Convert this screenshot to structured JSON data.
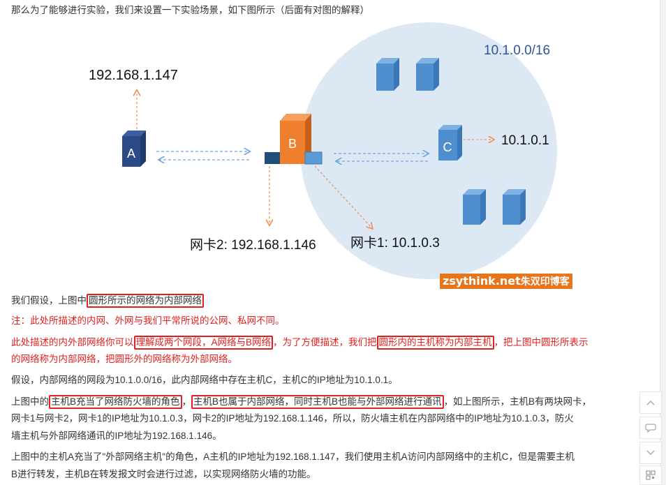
{
  "intro": "那么为了能够进行实验，我们来设置一下实验场景，如下图所示（后面有对图的解释）",
  "diagram": {
    "subnet_label": "10.1.0.0/16",
    "host_a_ip": "192.168.1.147",
    "host_a_label": "A",
    "host_b_label": "B",
    "host_c_label": "C",
    "host_c_ip": "10.1.0.1",
    "nic2_label": "网卡2: 192.168.1.146",
    "nic1_label": "网卡1: 10.1.0.3",
    "colors": {
      "circle": "#dce8f4",
      "host_dark": "#2c4a86",
      "host_blue": "#4f8fd0",
      "host_b": "#f07f2d",
      "arrow_orange": "#f0915a",
      "arrow_blue": "#6fa8dc"
    }
  },
  "watermark": {
    "site": "zsythink.net",
    "blog": "朱双印博客"
  },
  "paragraphs": {
    "p1_pre": "我们假设，上图中",
    "p1_box": "圆形所示的网络为内部网络",
    "note1": "注：此处所描述的内网、外网与我们平常所说的公网、私网不同。",
    "note2_pre": "此处描述的内外部网络你可以",
    "note2_box1": "理解成两个网段，A网络与B网络",
    "note2_mid": "，为了方便描述，我们把",
    "note2_box2": "圆形内的主机称为内部主机",
    "note2_post": "，把上图中圆形所表示",
    "note2_line2": "的网络称为内部网络，把圆形外的网络称为外部网络。",
    "p2": "假设，内部网络的网段为10.1.0.0/16，此内部网络中存在主机C，主机C的IP地址为10.1.0.1。",
    "p3_pre": "上图中的",
    "p3_box1": "主机B充当了网络防火墙的角色",
    "p3_mid": "，",
    "p3_box2": "主机B也属于内部网络，同时主机B也能与外部网络进行通讯",
    "p3_post": "，如上图所示，主机B有两块网卡，",
    "p3_line2": "网卡1与网卡2，网卡1的IP地址为10.1.0.3，网卡2的IP地址为192.168.1.146，所以，防火墙主机在内部网络中的IP地址为10.1.0.3，防火",
    "p3_line3": "墙主机与外部网络通讯的IP地址为192.168.1.146。",
    "p4_line1": "上图中的主机A充当了\"外部网络主机\"的角色，A主机的IP地址为192.168.1.147，我们使用主机A访问内部网络中的主机C，但是需要主机",
    "p4_line2": "B进行转发，主机B在转发报文时会进行过滤，以实现网络防火墙的功能。"
  },
  "sidebar": {
    "up_icon": "chevron-up-icon",
    "comment_icon": "comment-icon",
    "down_icon": "chevron-down-icon",
    "qr_icon": "qr-code-icon"
  }
}
